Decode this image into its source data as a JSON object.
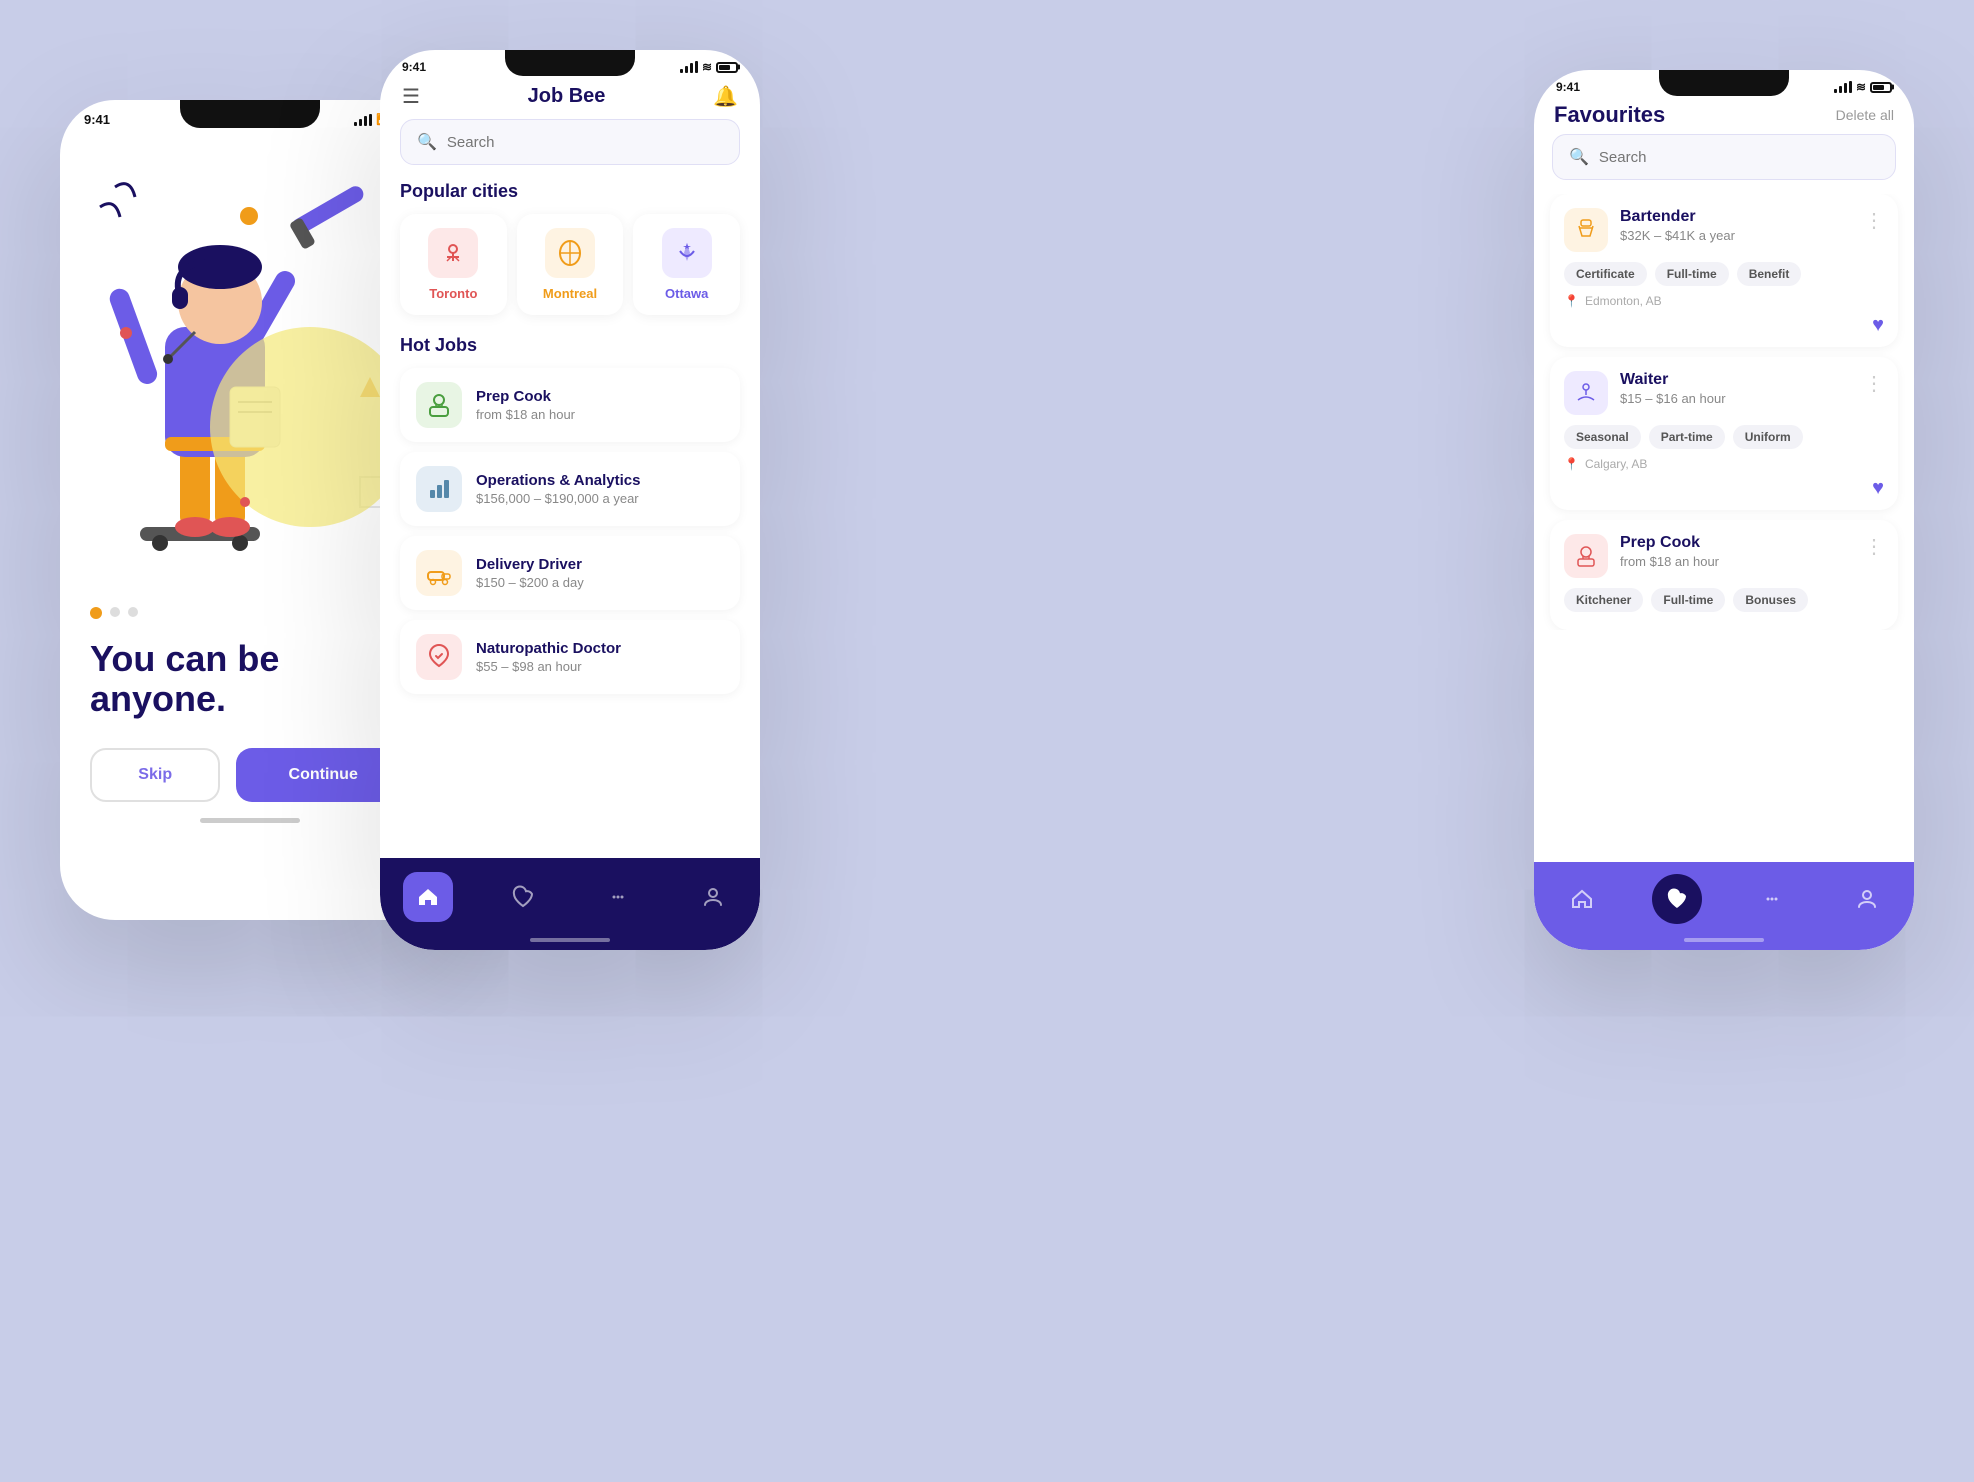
{
  "background": "#c8cde8",
  "phone_left": {
    "status": {
      "time": "9:41",
      "signal": "signal",
      "wifi": "wifi",
      "battery": "battery"
    },
    "tagline_line1": "You can be",
    "tagline_line2": "anyone.",
    "skip_label": "Skip",
    "continue_label": "Continue",
    "progress_dots": [
      "active",
      "inactive",
      "inactive"
    ]
  },
  "phone_mid": {
    "status": {
      "time": "9:41",
      "signal": "signal",
      "wifi": "wifi",
      "battery": "battery"
    },
    "header": {
      "menu_icon": "☰",
      "title": "Job Bee",
      "bell_icon": "🔔"
    },
    "search_placeholder": "Search",
    "popular_cities_title": "Popular cities",
    "cities": [
      {
        "name": "Toronto",
        "icon": "🏗",
        "style": "toronto"
      },
      {
        "name": "Montreal",
        "icon": "🏛",
        "style": "montreal"
      },
      {
        "name": "Ottawa",
        "icon": "🍁",
        "style": "ottawa"
      }
    ],
    "hot_jobs_title": "Hot Jobs",
    "jobs": [
      {
        "title": "Prep Cook",
        "pay": "from $18 an hour",
        "icon": "👨‍🍳",
        "style": "green"
      },
      {
        "title": "Operations & Analytics",
        "pay": "$156,000 – $190,000 a year",
        "icon": "📊",
        "style": "blue"
      },
      {
        "title": "Delivery Driver",
        "pay": "$150 – $200 a day",
        "icon": "🚚",
        "style": "orange"
      },
      {
        "title": "Naturopathic Doctor",
        "pay": "$55 – $98 an hour",
        "icon": "❤️",
        "style": "pink"
      }
    ],
    "nav": [
      {
        "icon": "🏠",
        "active": true
      },
      {
        "icon": "♡",
        "active": false
      },
      {
        "icon": "💬",
        "active": false
      },
      {
        "icon": "👤",
        "active": false
      }
    ]
  },
  "phone_right": {
    "status": {
      "time": "9:41",
      "signal": "signal",
      "wifi": "wifi",
      "battery": "battery"
    },
    "title": "Favourites",
    "delete_all_label": "Delete all",
    "search_placeholder": "Search",
    "favourites": [
      {
        "title": "Bartender",
        "pay": "$32K – $41K a year",
        "icon": "🍺",
        "icon_style": "yellow",
        "tags": [
          "Certificate",
          "Full-time",
          "Benefit"
        ],
        "location": "Edmonton, AB"
      },
      {
        "title": "Waiter",
        "pay": "$15 – $16 an hour",
        "icon": "🍽",
        "icon_style": "purple",
        "tags": [
          "Seasonal",
          "Part-time",
          "Uniform"
        ],
        "location": "Calgary, AB"
      },
      {
        "title": "Prep Cook",
        "pay": "from $18 an hour",
        "icon": "👨‍🍳",
        "icon_style": "pink",
        "tags": [
          "Kitchener",
          "Full-time",
          "Bonuses"
        ],
        "location": ""
      }
    ],
    "nav": [
      {
        "icon": "🏠",
        "active": false
      },
      {
        "icon": "♥",
        "active": true
      },
      {
        "icon": "💬",
        "active": false
      },
      {
        "icon": "👤",
        "active": false
      }
    ]
  }
}
